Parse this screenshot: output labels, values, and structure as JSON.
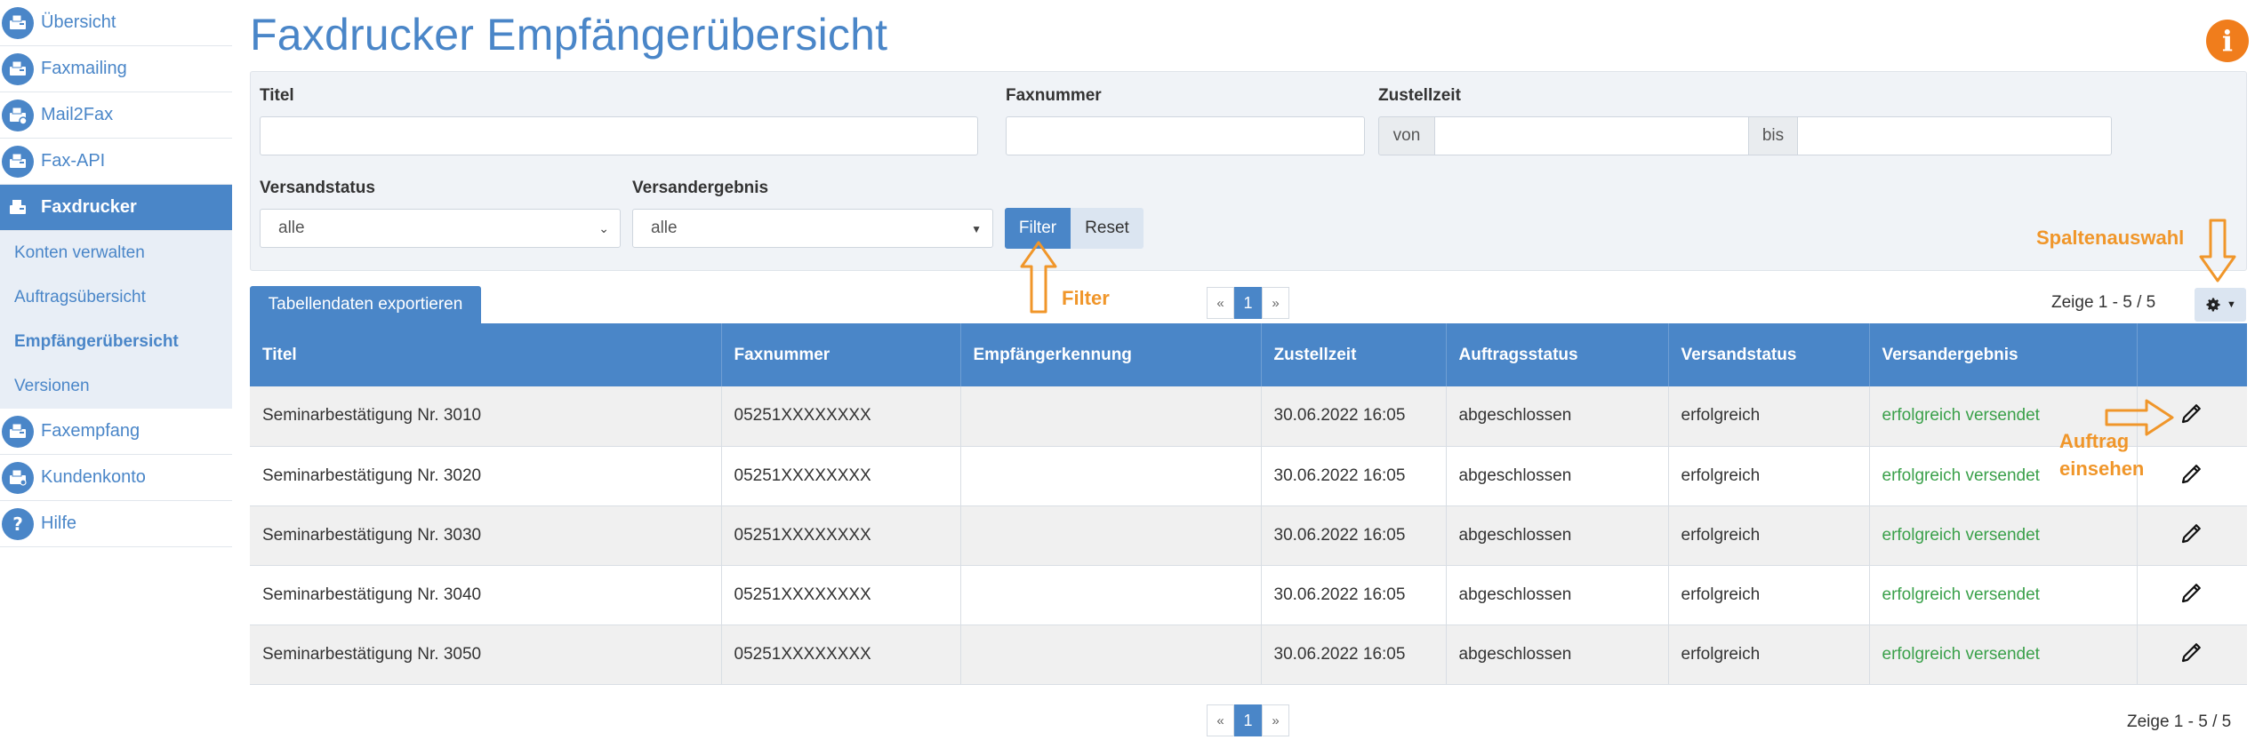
{
  "sidebar": {
    "items": [
      {
        "label": "Übersicht",
        "icon": "fax-icon"
      },
      {
        "label": "Faxmailing",
        "icon": "fax-icon"
      },
      {
        "label": "Mail2Fax",
        "icon": "mail-fax-icon"
      },
      {
        "label": "Fax-API",
        "icon": "fax-icon"
      },
      {
        "label": "Faxdrucker",
        "icon": "fax-printer-icon"
      }
    ],
    "sub_items": [
      {
        "label": "Konten verwalten"
      },
      {
        "label": "Auftragsübersicht"
      },
      {
        "label": "Empfängerübersicht"
      },
      {
        "label": "Versionen"
      }
    ],
    "items_after": [
      {
        "label": "Faxempfang",
        "icon": "fax-icon"
      },
      {
        "label": "Kundenkonto",
        "icon": "user-icon"
      },
      {
        "label": "Hilfe",
        "icon": "help-icon"
      }
    ]
  },
  "page": {
    "title": "Faxdrucker Empfängerübersicht",
    "info_label": "i"
  },
  "filter": {
    "titel_label": "Titel",
    "faxnummer_label": "Faxnummer",
    "zustellzeit_label": "Zustellzeit",
    "von_label": "von",
    "bis_label": "bis",
    "versandstatus_label": "Versandstatus",
    "versandstatus_value": "alle",
    "versandergebnis_label": "Versandergebnis",
    "versandergebnis_value": "alle",
    "filter_button": "Filter",
    "reset_button": "Reset"
  },
  "toolbar": {
    "export_button": "Tabellendaten exportieren",
    "pager": {
      "prev": "«",
      "current": "1",
      "next": "»"
    },
    "count_text": "Zeige 1 - 5 / 5",
    "count_text_bottom": "Zeige 1 - 5 / 5"
  },
  "table": {
    "columns": [
      "Titel",
      "Faxnummer",
      "Empfängerkennung",
      "Zustellzeit",
      "Auftragsstatus",
      "Versandstatus",
      "Versandergebnis",
      ""
    ],
    "rows": [
      {
        "titel": "Seminarbestätigung Nr. 3010",
        "faxnummer": "05251XXXXXXXX",
        "kennung": "",
        "zeit": "30.06.2022 16:05",
        "auftrag": "abgeschlossen",
        "status": "erfolgreich",
        "ergebnis": "erfolgreich versendet"
      },
      {
        "titel": "Seminarbestätigung Nr. 3020",
        "faxnummer": "05251XXXXXXXX",
        "kennung": "",
        "zeit": "30.06.2022 16:05",
        "auftrag": "abgeschlossen",
        "status": "erfolgreich",
        "ergebnis": "erfolgreich versendet"
      },
      {
        "titel": "Seminarbestätigung Nr. 3030",
        "faxnummer": "05251XXXXXXXX",
        "kennung": "",
        "zeit": "30.06.2022 16:05",
        "auftrag": "abgeschlossen",
        "status": "erfolgreich",
        "ergebnis": "erfolgreich versendet"
      },
      {
        "titel": "Seminarbestätigung Nr. 3040",
        "faxnummer": "05251XXXXXXXX",
        "kennung": "",
        "zeit": "30.06.2022 16:05",
        "auftrag": "abgeschlossen",
        "status": "erfolgreich",
        "ergebnis": "erfolgreich versendet"
      },
      {
        "titel": "Seminarbestätigung Nr. 3050",
        "faxnummer": "05251XXXXXXXX",
        "kennung": "",
        "zeit": "30.06.2022 16:05",
        "auftrag": "abgeschlossen",
        "status": "erfolgreich",
        "ergebnis": "erfolgreich versendet"
      }
    ]
  },
  "annotations": {
    "filter": "Filter",
    "spaltenauswahl": "Spaltenauswahl",
    "auftrag_line1": "Auftrag",
    "auftrag_line2": "einsehen"
  },
  "colors": {
    "primary": "#4a86c8",
    "accent_orange": "#f0962a",
    "success_green": "#3aa04a"
  }
}
